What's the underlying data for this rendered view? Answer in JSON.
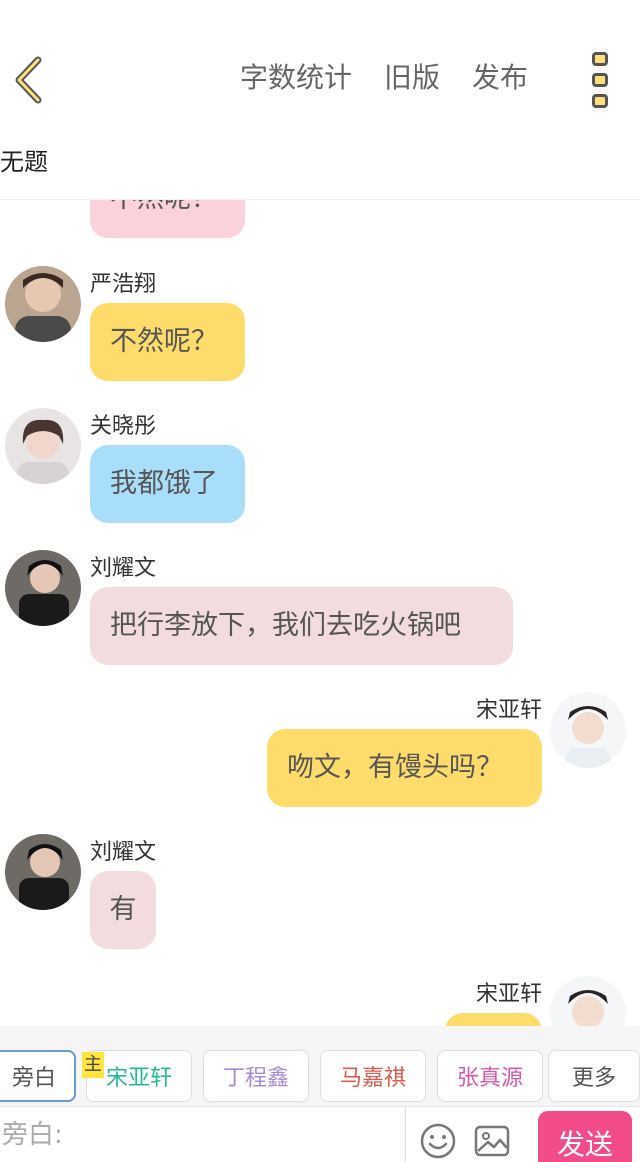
{
  "header": {
    "actions": [
      "字数统计",
      "旧版",
      "发布"
    ],
    "doc_title": "无题"
  },
  "messages": [
    {
      "name": "",
      "text": "不然呢？",
      "side": "left",
      "color": "#fbd2dc"
    },
    {
      "name": "严浩翔",
      "text": "不然呢？",
      "side": "left",
      "color": "#fedc6c"
    },
    {
      "name": "关晓彤",
      "text": "我都饿了",
      "side": "left",
      "color": "#a9defa"
    },
    {
      "name": "刘耀文",
      "text": "把行李放下，我们去吃火锅吧",
      "side": "left",
      "color": "#f2dcdd"
    },
    {
      "name": "宋亚轩",
      "text": "吻文，有馒头吗？",
      "side": "right",
      "color": "#fedc6c"
    },
    {
      "name": "刘耀文",
      "text": "有",
      "side": "left",
      "color": "#f2dcdd"
    },
    {
      "name": "宋亚轩",
      "text": "",
      "side": "right",
      "color": "#fedc6c"
    }
  ],
  "roles": [
    {
      "label": "旁白",
      "color": "#555555"
    },
    {
      "label": "宋亚轩",
      "color": "#27b89c"
    },
    {
      "label": "丁程鑫",
      "color": "#a78bd0"
    },
    {
      "label": "马嘉祺",
      "color": "#e05a4f"
    },
    {
      "label": "张真源",
      "color": "#d55ba8"
    },
    {
      "label": "更多",
      "color": "#555555"
    }
  ],
  "host_tag": "主",
  "input": {
    "placeholder": "旁白:"
  },
  "send_label": "发送"
}
